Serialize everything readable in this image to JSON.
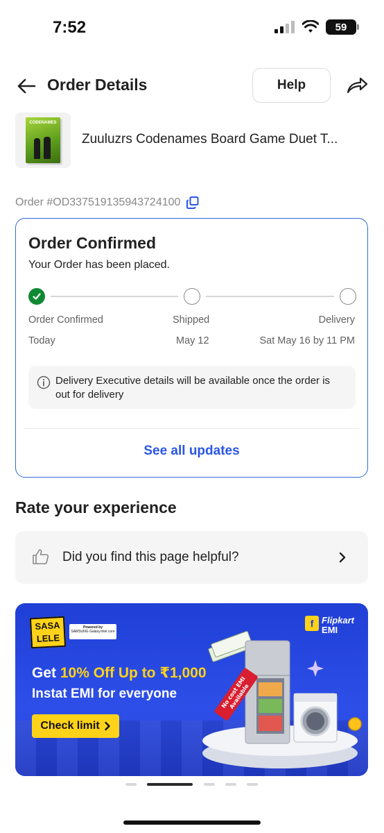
{
  "status_bar": {
    "time": "7:52",
    "battery": "59"
  },
  "header": {
    "title": "Order Details",
    "help_label": "Help"
  },
  "product": {
    "name": "Zuuluzrs Codenames Board Game Duet T...",
    "thumbnail_box_text": "CODENAMES"
  },
  "order": {
    "id_text": "Order #OD337519135943724100"
  },
  "tracking": {
    "title": "Order Confirmed",
    "subtitle": "Your Order has been placed.",
    "steps": [
      {
        "label": "Order Confirmed",
        "date": "Today",
        "done": true
      },
      {
        "label": "Shipped",
        "date": "May 12",
        "done": false
      },
      {
        "label": "Delivery",
        "date": "Sat May 16 by 11 PM",
        "done": false
      }
    ],
    "info_text": "Delivery Executive details will be available once the order is out for delivery",
    "see_all_label": "See all updates",
    "accent_color": "#2f6cd6",
    "done_color": "#108934"
  },
  "rate": {
    "heading": "Rate your experience",
    "helpful_question": "Did you find this page helpful?"
  },
  "banner": {
    "logo_line1": "SASA",
    "logo_line2": "LELE",
    "powered_by": "Powered by",
    "partner1": "SAMSUNG Galaxy",
    "partner2": "intel core",
    "brand_line1": "Flipkart",
    "brand_line2": "EMI",
    "headline_prefix": "Get ",
    "headline_highlight": "10% Off Up to ₹1,000",
    "subline": "Instat EMI for everyone",
    "cta_label": "Check limit",
    "tag_line1": "No cost EMI",
    "tag_line2": "Available"
  },
  "carousel": {
    "count": 6,
    "active_index": 1
  }
}
